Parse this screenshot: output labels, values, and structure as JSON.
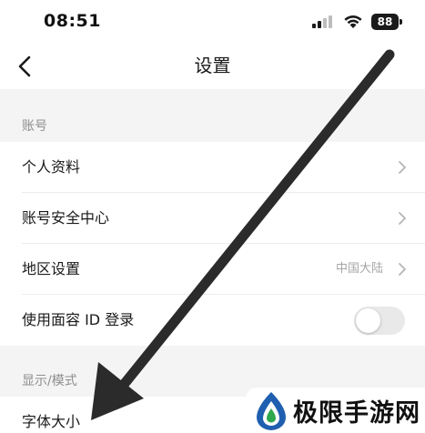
{
  "status_bar": {
    "time": "08:51",
    "battery": "88"
  },
  "nav": {
    "title": "设置",
    "back_icon": "chevron-left-icon"
  },
  "sections": [
    {
      "header": "账号",
      "rows": [
        {
          "label": "个人资料",
          "accessory": "chevron"
        },
        {
          "label": "账号安全中心",
          "accessory": "chevron"
        },
        {
          "label": "地区设置",
          "value": "中国大陆",
          "accessory": "chevron"
        },
        {
          "label": "使用面容 ID 登录",
          "accessory": "toggle",
          "toggle_on": false
        }
      ]
    },
    {
      "header": "显示/模式",
      "rows": [
        {
          "label": "字体大小",
          "accessory": "chevron"
        }
      ]
    }
  ],
  "annotation": {
    "arrow_color": "#2b2b2b"
  },
  "watermark": {
    "text": "极限手游网"
  },
  "colors": {
    "section_bg": "#f4f4f4",
    "secondary_text": "#8e8e8e",
    "brand_blue": "#1f5fb0",
    "brand_green": "#2fa84f"
  }
}
